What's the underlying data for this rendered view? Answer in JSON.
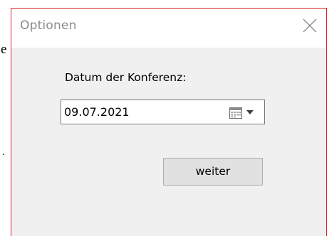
{
  "background_document": {
    "fragment_1": "e",
    "fragment_2": "."
  },
  "dialog": {
    "title": "Optionen",
    "close_icon": "close-icon",
    "date_label": "Datum der Konferenz:",
    "date_value": "09.07.2021",
    "calendar_icon": "calendar-icon",
    "dropdown_icon": "chevron-down-icon",
    "next_button_label": "weiter"
  },
  "colors": {
    "window_border": "#e0262c",
    "title_text": "#8a8a8a",
    "client_background": "#f0f0f0",
    "button_face": "#e1e1e1"
  }
}
